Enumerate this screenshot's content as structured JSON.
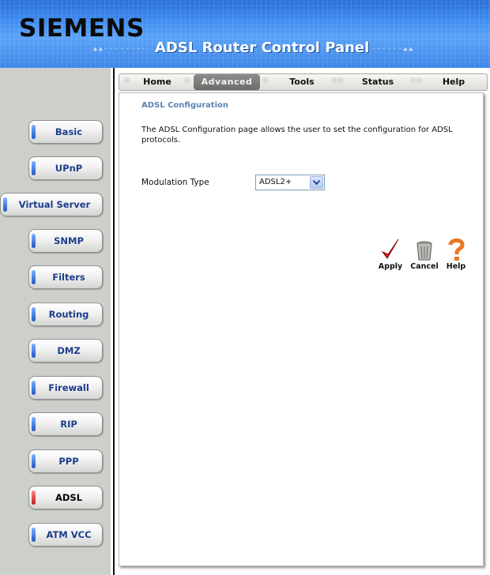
{
  "header": {
    "logo": "SIEMENS",
    "title": "ADSL Router Control Panel"
  },
  "tabs": [
    {
      "label": "Home"
    },
    {
      "label": "Advanced"
    },
    {
      "label": "Tools"
    },
    {
      "label": "Status"
    },
    {
      "label": "Help"
    }
  ],
  "active_tab": "Advanced",
  "sidebar": {
    "items": [
      {
        "label": "Basic"
      },
      {
        "label": "UPnP"
      },
      {
        "label": "Virtual Server"
      },
      {
        "label": "SNMP"
      },
      {
        "label": "Filters"
      },
      {
        "label": "Routing"
      },
      {
        "label": "DMZ"
      },
      {
        "label": "Firewall"
      },
      {
        "label": "RIP"
      },
      {
        "label": "PPP"
      },
      {
        "label": "ADSL"
      },
      {
        "label": "ATM VCC"
      }
    ],
    "active_item": "ADSL"
  },
  "main": {
    "title": "ADSL Configuration",
    "description": "The ADSL Configuration page allows the user to set the configuration for ADSL protocols.",
    "modulation": {
      "label": "Modulation Type",
      "value": "ADSL2+"
    },
    "actions": {
      "apply": "Apply",
      "cancel": "Cancel",
      "help": "Help"
    }
  },
  "colors": {
    "banner": "#3f8cf0",
    "sidebar_bg": "#cdcfcb",
    "nav_label": "#1d3d8c",
    "active_pill": "#c21a1a",
    "title_text": "#5d83b0"
  }
}
